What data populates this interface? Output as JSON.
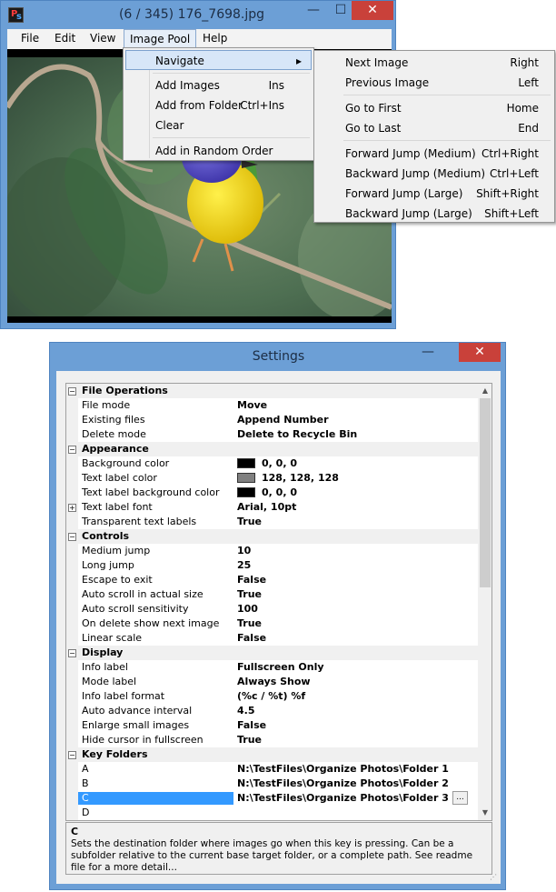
{
  "viewer": {
    "title": "(6 / 345) 176_7698.jpg",
    "menus": [
      "File",
      "Edit",
      "View",
      "Image Pool",
      "Help"
    ],
    "image_pool_menu": [
      {
        "label": "Navigate",
        "key": "▸",
        "highlighted": true
      },
      {
        "label": "Add  Images",
        "key": "Ins"
      },
      {
        "label": "Add from Folder",
        "key": "Ctrl+Ins"
      },
      {
        "label": "Clear",
        "key": ""
      },
      {
        "label": "Add in Random Order",
        "key": ""
      }
    ],
    "navigate_menu": [
      {
        "label": "Next Image",
        "key": "Right"
      },
      {
        "label": "Previous Image",
        "key": "Left"
      },
      {
        "label": "Go to First",
        "key": "Home"
      },
      {
        "label": "Go to Last",
        "key": "End"
      },
      {
        "label": "Forward Jump (Medium)",
        "key": "Ctrl+Right"
      },
      {
        "label": "Backward Jump (Medium)",
        "key": "Ctrl+Left"
      },
      {
        "label": "Forward Jump (Large)",
        "key": "Shift+Right"
      },
      {
        "label": "Backward Jump (Large)",
        "key": "Shift+Left"
      }
    ]
  },
  "settings": {
    "title": "Settings",
    "rows": [
      {
        "type": "cat",
        "label": "File Operations",
        "exp": "−"
      },
      {
        "label": "File mode",
        "value": "Move"
      },
      {
        "label": "Existing files",
        "value": "Append Number"
      },
      {
        "label": "Delete mode",
        "value": "Delete to Recycle Bin"
      },
      {
        "type": "cat",
        "label": "Appearance",
        "exp": "−"
      },
      {
        "label": "Background color",
        "value": "0, 0, 0",
        "swatch": "#000000"
      },
      {
        "label": "Text label color",
        "value": "128, 128, 128",
        "swatch": "#808080"
      },
      {
        "label": "Text label background color",
        "value": "0, 0, 0",
        "swatch": "#000000"
      },
      {
        "label": "Text label font",
        "value": "Arial, 10pt",
        "exp": "+"
      },
      {
        "label": "Transparent text labels",
        "value": "True"
      },
      {
        "type": "cat",
        "label": "Controls",
        "exp": "−"
      },
      {
        "label": "Medium jump",
        "value": "10"
      },
      {
        "label": "Long jump",
        "value": "25"
      },
      {
        "label": "Escape to exit",
        "value": "False"
      },
      {
        "label": "Auto scroll in actual size",
        "value": "True"
      },
      {
        "label": "Auto scroll sensitivity",
        "value": "100"
      },
      {
        "label": "On delete show next image",
        "value": "True"
      },
      {
        "label": "Linear scale",
        "value": "False"
      },
      {
        "type": "cat",
        "label": "Display",
        "exp": "−"
      },
      {
        "label": "Info label",
        "value": "Fullscreen Only"
      },
      {
        "label": "Mode label",
        "value": "Always Show"
      },
      {
        "label": "Info label format",
        "value": "(%c / %t) %f"
      },
      {
        "label": "Auto advance interval",
        "value": "4.5"
      },
      {
        "label": "Enlarge small images",
        "value": "False"
      },
      {
        "label": "Hide cursor in fullscreen",
        "value": "True"
      },
      {
        "type": "cat",
        "label": "Key Folders",
        "exp": "−"
      },
      {
        "label": "A",
        "value": "N:\\TestFiles\\Organize Photos\\Folder 1"
      },
      {
        "label": "B",
        "value": "N:\\TestFiles\\Organize Photos\\Folder 2"
      },
      {
        "label": "C",
        "value": "N:\\TestFiles\\Organize Photos\\Folder 3",
        "selected": true,
        "button": "..."
      },
      {
        "label": "D",
        "value": ""
      }
    ],
    "description": {
      "title": "C",
      "text": "Sets the destination folder where images go when this key is pressing. Can be a subfolder relative to the current base target folder, or a complete path. See readme file for a more detail..."
    }
  },
  "colors": {
    "title_bar": "#6c9fd6",
    "selection": "#3399ff",
    "close_button": "#c9413a"
  }
}
